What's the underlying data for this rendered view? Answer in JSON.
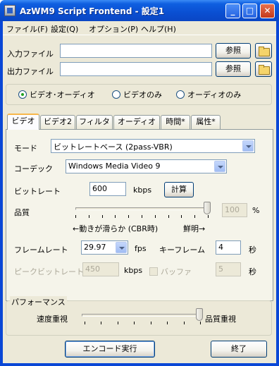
{
  "window": {
    "title": "AzWM9 Script Frontend - 設定1"
  },
  "menu": [
    "ファイル(F)",
    "設定(Q)",
    "オプション(P)",
    "ヘルプ(H)"
  ],
  "files": {
    "input_label": "入力ファイル",
    "input_value": "",
    "output_label": "出力ファイル",
    "output_value": "",
    "browse_label": "参照"
  },
  "stream_mode": {
    "options": [
      "ビデオ･オーディオ",
      "ビデオのみ",
      "オーディオのみ"
    ],
    "selected": "ビデオ･オーディオ"
  },
  "tabs": [
    "ビデオ",
    "ビデオ2",
    "フィルタ",
    "オーディオ",
    "時間*",
    "属性*"
  ],
  "active_tab": "ビデオ",
  "video": {
    "mode_label": "モード",
    "mode_value": "ビットレートベース (2pass-VBR)",
    "codec_label": "コーデック",
    "codec_value": "Windows Media Video 9",
    "bitrate_label": "ビットレート",
    "bitrate_value": "600",
    "bitrate_unit": "kbps",
    "calc_button": "計算",
    "quality_label": "品質",
    "quality_value": "100",
    "quality_unit": "%",
    "quality_slider_fraction": 1.0,
    "quality_hint_left": "←動きが滑らか (CBR時)",
    "quality_hint_right": "鮮明→",
    "framerate_label": "フレームレート",
    "framerate_value": "29.97",
    "framerate_unit": "fps",
    "keyframe_label": "キーフレーム",
    "keyframe_value": "4",
    "keyframe_unit": "秒",
    "peak_label": "ピークビットレート",
    "peak_value": "450",
    "peak_unit": "kbps",
    "buffer_label": "バッファ",
    "buffer_value": "5",
    "buffer_unit": "秒"
  },
  "performance": {
    "title": "パフォーマンス",
    "left_label": "速度重視",
    "right_label": "品質重視",
    "slider_fraction": 1.0
  },
  "buttons": {
    "encode": "エンコード実行",
    "exit": "終了"
  },
  "colors": {
    "titlebar": "#0a4fd2",
    "face": "#ece9d8",
    "panel": "#f5f4ea",
    "tab_highlight": "#f7b64a"
  }
}
